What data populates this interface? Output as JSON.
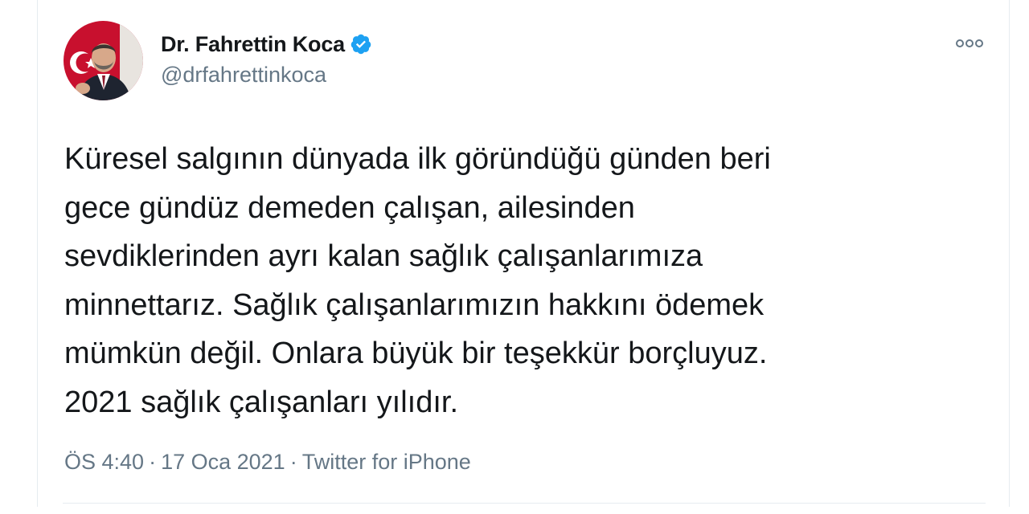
{
  "author": {
    "display_name": "Dr. Fahrettin Koca",
    "handle": "@drfahrettinkoca",
    "verified": true
  },
  "tweet": {
    "lines": [
      "Küresel salgının dünyada ilk göründüğü günden beri",
      "gece gündüz demeden çalışan, ailesinden",
      "sevdiklerinden ayrı kalan sağlık çalışanlarımıza",
      "minnettarız. Sağlık çalışanlarımızın hakkını ödemek",
      "mümkün değil. Onlara büyük bir teşekkür borçluyuz.",
      "2021 sağlık çalışanları yılıdır."
    ]
  },
  "meta": {
    "time": "ÖS 4:40",
    "date": "17 Oca 2021",
    "source": "Twitter for iPhone",
    "separator": "·"
  },
  "colors": {
    "verified_badge": "#1da1f2",
    "text_primary": "#14171a",
    "text_secondary": "#657786",
    "border": "#e6ecf0"
  },
  "icons": {
    "verified": "verified-badge-icon",
    "more": "more-options-icon"
  }
}
